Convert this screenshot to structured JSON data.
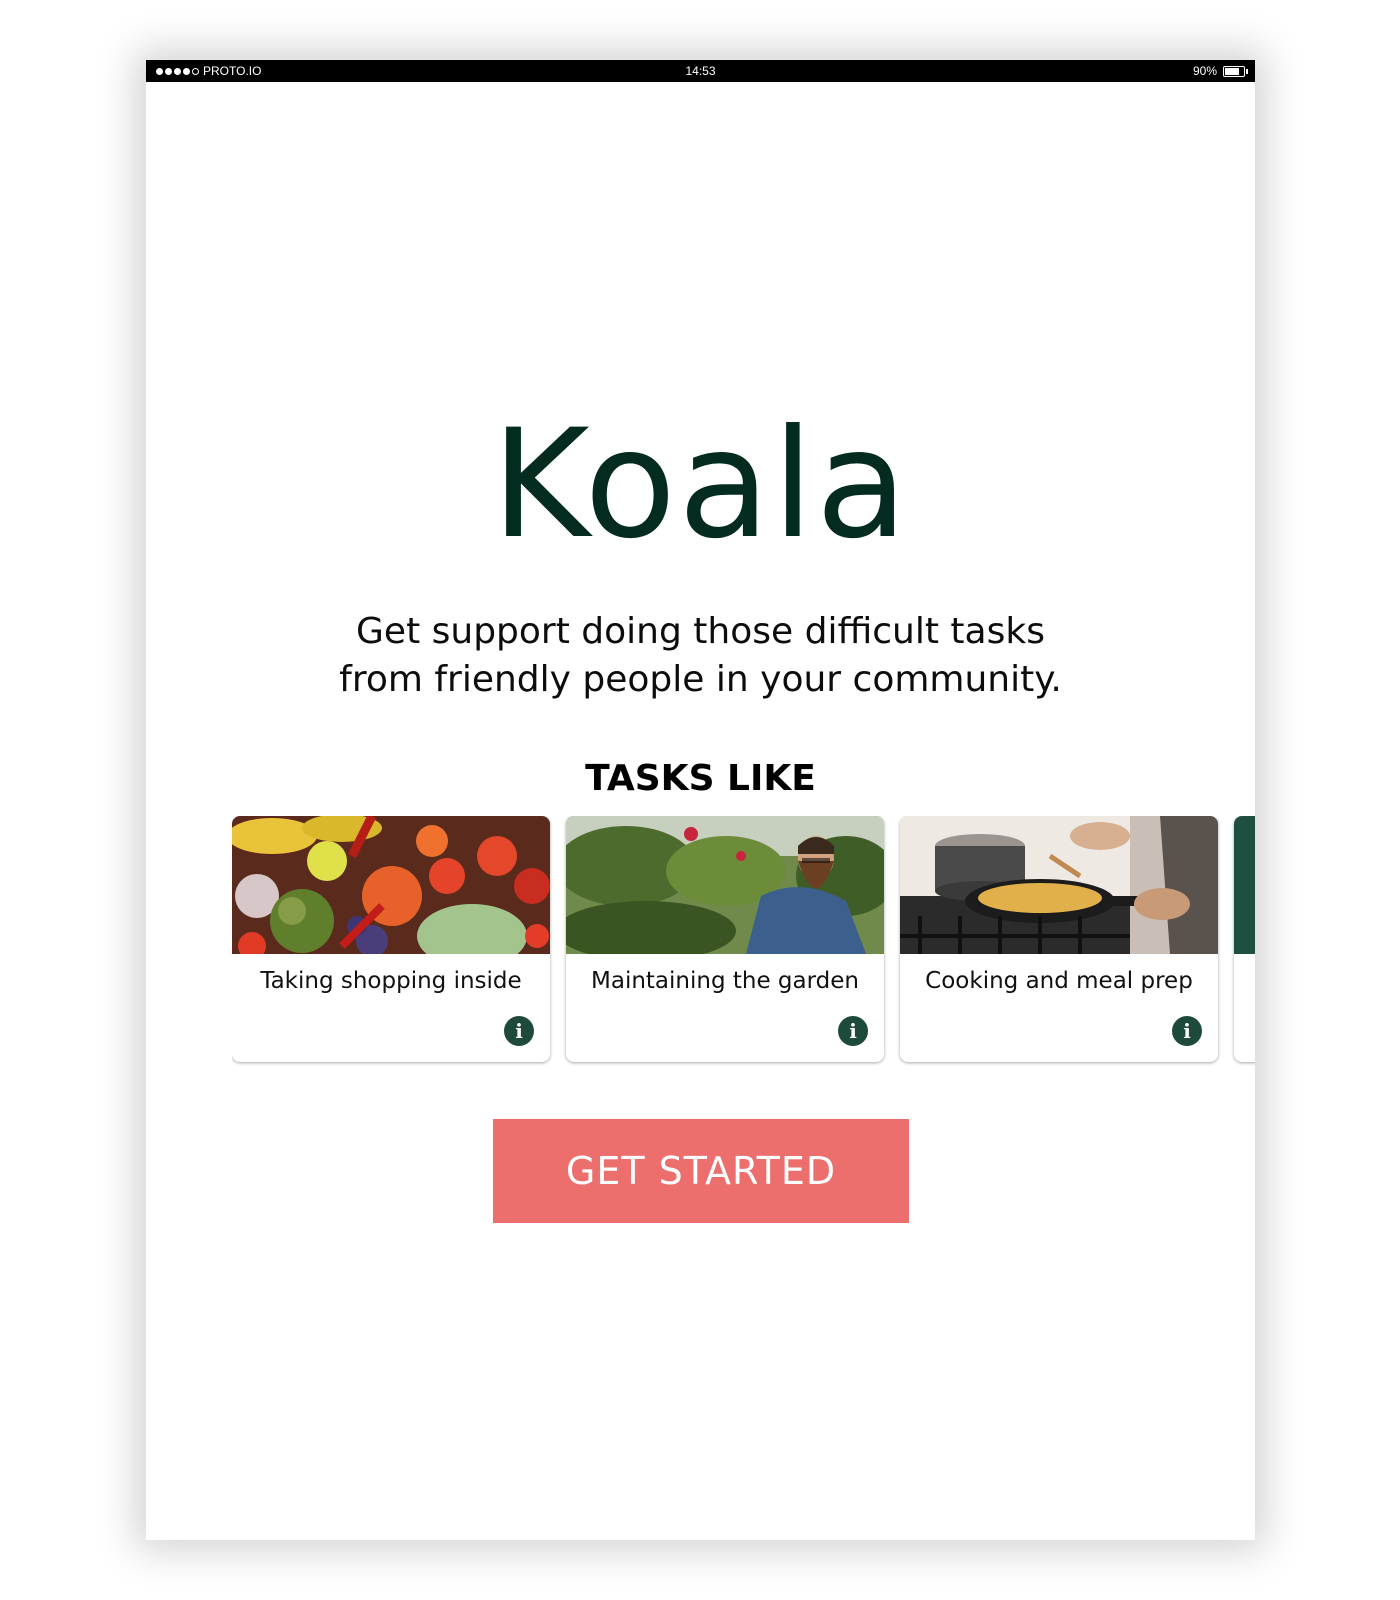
{
  "status_bar": {
    "carrier": "PROTO.IO",
    "signal_bars": 4,
    "signal_max": 5,
    "time": "14:53",
    "battery_percent": "90%",
    "battery_level": 0.9
  },
  "app": {
    "title": "Koala",
    "subtitle_line1": "Get support doing those difficult tasks",
    "subtitle_line2": "from friendly people in your community.",
    "tasks_heading": "TASKS LIKE"
  },
  "tasks": [
    {
      "label": "Taking shopping inside",
      "image": "fruits-and-vegetables-photo",
      "icon": "info-icon"
    },
    {
      "label": "Maintaining the garden",
      "image": "man-gardening-photo",
      "icon": "info-icon"
    },
    {
      "label": "Cooking and meal prep",
      "image": "cooking-on-stove-photo",
      "icon": "info-icon"
    },
    {
      "label": "",
      "image": "green-card-partial",
      "icon": "info-icon"
    }
  ],
  "cta": {
    "label": "GET STARTED"
  },
  "colors": {
    "title": "#032b1f",
    "accent_green": "#1e4a3c",
    "button": "#ec6e6d",
    "status_bar": "#000000"
  }
}
